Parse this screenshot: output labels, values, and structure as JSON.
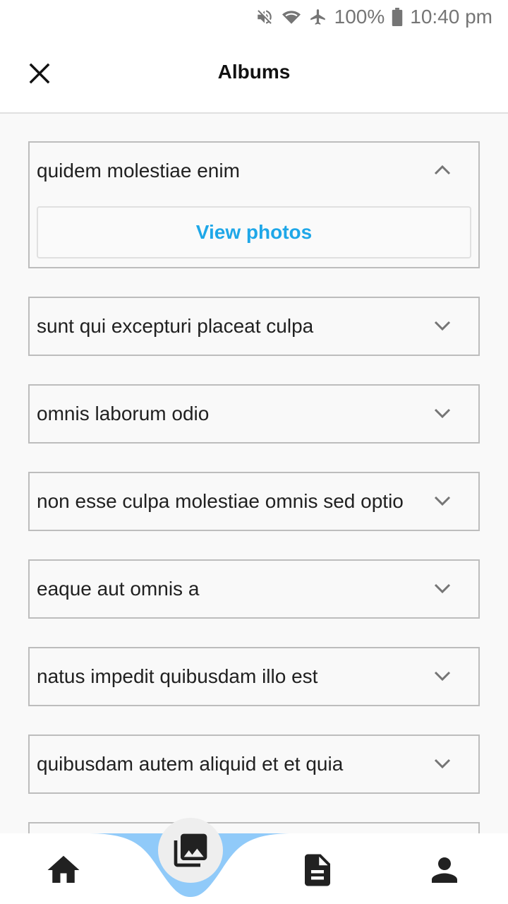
{
  "status_bar": {
    "battery_percent": "100%",
    "time": "10:40 pm",
    "icons": [
      "mute-icon",
      "wifi-icon",
      "airplane-icon",
      "battery-icon"
    ]
  },
  "app_bar": {
    "title": "Albums",
    "close_icon": "close-icon"
  },
  "albums": [
    {
      "title": "quidem molestiae enim",
      "expanded": true,
      "action_label": "View photos"
    },
    {
      "title": "sunt qui excepturi placeat culpa",
      "expanded": false
    },
    {
      "title": "omnis laborum odio",
      "expanded": false
    },
    {
      "title": "non esse culpa molestiae omnis sed optio",
      "expanded": false
    },
    {
      "title": "eaque aut omnis a",
      "expanded": false
    },
    {
      "title": "natus impedit quibusdam illo est",
      "expanded": false
    },
    {
      "title": "quibusdam autem aliquid et et quia",
      "expanded": false
    }
  ],
  "bottom_nav": {
    "items": [
      "home-icon",
      "photo-library-icon",
      "document-icon",
      "person-icon"
    ],
    "active": "photo-library-icon"
  },
  "colors": {
    "accent": "#1ea7e8",
    "nav_wave": "#90caf9",
    "border": "#bdbdbd",
    "background": "#f9f9f9"
  }
}
